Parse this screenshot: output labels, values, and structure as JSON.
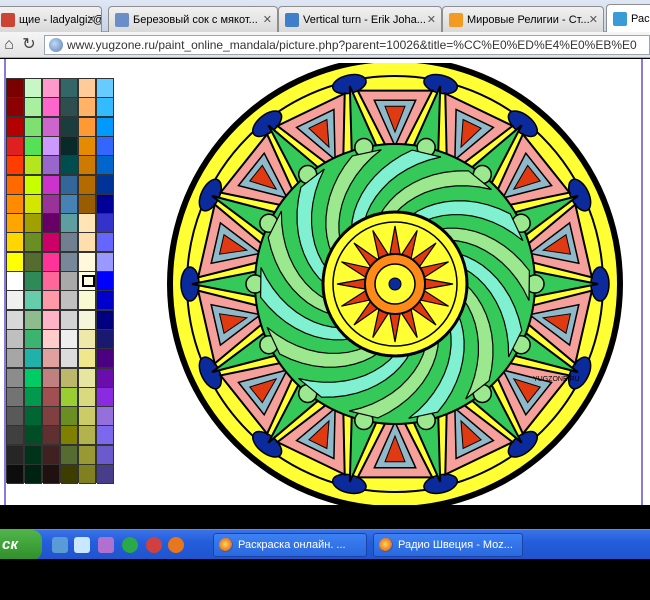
{
  "browser": {
    "tabs": [
      {
        "label": "щие - ladyalgiz@...",
        "favicon": "mail",
        "fav_color": "#c43",
        "active": false
      },
      {
        "label": "Березовый сок с мякот...",
        "favicon": "person",
        "fav_color": "#6a8fc7",
        "active": false
      },
      {
        "label": "Vertical turn - Erik Joha...",
        "favicon": "page",
        "fav_color": "#3f7ec9",
        "active": false
      },
      {
        "label": "Мировые Религии - Ст...",
        "favicon": "orange",
        "fav_color": "#f39a22",
        "active": false
      },
      {
        "label": "Рас",
        "favicon": "yz",
        "fav_color": "#3b9bd6",
        "active": true
      }
    ],
    "url": "www.yugzone.ru/paint_online_mandala/picture.php?parent=10026&title=%CC%E0%ED%E4%E0%EB%E0"
  },
  "palette": {
    "columns": [
      [
        "#7a0000",
        "#8b0000",
        "#b30000",
        "#e02020",
        "#ff3d00",
        "#ff6a00",
        "#ff8c00",
        "#ffa500",
        "#ffd700",
        "#ffff00",
        "#ffffff",
        "#f0f0f0",
        "#d8d8d8",
        "#bfbfbf",
        "#a6a6a6",
        "#8c8c8c",
        "#737373",
        "#595959",
        "#404040",
        "#262626",
        "#0d0d0d"
      ],
      [
        "#c8f7c5",
        "#a8f0a0",
        "#7ee070",
        "#55e055",
        "#b5e61d",
        "#c8ff00",
        "#d4e600",
        "#a0a000",
        "#6b8e23",
        "#556b2f",
        "#2e8b57",
        "#66cdaa",
        "#8fbc8f",
        "#3cb371",
        "#20b2aa",
        "#00cc66",
        "#00994d",
        "#006633",
        "#004d26",
        "#003319",
        "#002211"
      ],
      [
        "#ff99cc",
        "#ff66cc",
        "#cc66cc",
        "#cc99ff",
        "#9966cc",
        "#cc33cc",
        "#993399",
        "#660066",
        "#cc0066",
        "#ff3399",
        "#ff6699",
        "#ff99aa",
        "#ffb3c6",
        "#ffcccc",
        "#e0a0a0",
        "#c08080",
        "#a05050",
        "#804040",
        "#603030",
        "#402020",
        "#201010"
      ],
      [
        "#336666",
        "#2f4f4f",
        "#1c3d3d",
        "#0a2a2a",
        "#004d4d",
        "#336699",
        "#4682b4",
        "#5f9ea0",
        "#708090",
        "#778899",
        "#a9a9a9",
        "#c0c0c0",
        "#d3d3d3",
        "#eeeeee",
        "#dcdcdc",
        "#bdb76b",
        "#9acd32",
        "#6b8e23",
        "#808000",
        "#556b2f",
        "#3d3d00"
      ],
      [
        "#ffcc99",
        "#ffb366",
        "#ff9933",
        "#e68a00",
        "#cc7a00",
        "#b36b00",
        "#995c00",
        "#ffe4b5",
        "#ffdead",
        "#fff8dc",
        "#ffffe0",
        "#fafad2",
        "#f5f5dc",
        "#eee8aa",
        "#f0e68c",
        "#e6e6a0",
        "#d9d980",
        "#cccc66",
        "#b3b34d",
        "#999933",
        "#808020"
      ],
      [
        "#66ccff",
        "#33bbff",
        "#0099ff",
        "#3366ff",
        "#0066cc",
        "#003399",
        "#000099",
        "#3333cc",
        "#6666ff",
        "#9999ff",
        "#0000ff",
        "#0000cc",
        "#000080",
        "#191970",
        "#4b0082",
        "#6a0dad",
        "#8a2be2",
        "#9370db",
        "#7b68ee",
        "#6a5acd",
        "#483d8b"
      ]
    ],
    "selected": {
      "column": 4,
      "row": 10
    }
  },
  "colors": {
    "mandala_yellow": "#ffff33",
    "mandala_pink": "#f5a09a",
    "mandala_green": "#35c95a",
    "mandala_light_green": "#9be88f",
    "mandala_aqua": "#7ff0d0",
    "mandala_orange": "#ff8a1a",
    "mandala_red": "#e03a12",
    "mandala_blue": "#0b2a9c",
    "mandala_gray_blue": "#8fb8c8"
  },
  "mandala": {
    "signature": "YUGZONE.RU"
  },
  "taskbar": {
    "start_label": "ск",
    "buttons": [
      {
        "label": "Раскраска онлайн. ..."
      },
      {
        "label": "Радио Швеция - Moz..."
      }
    ]
  }
}
